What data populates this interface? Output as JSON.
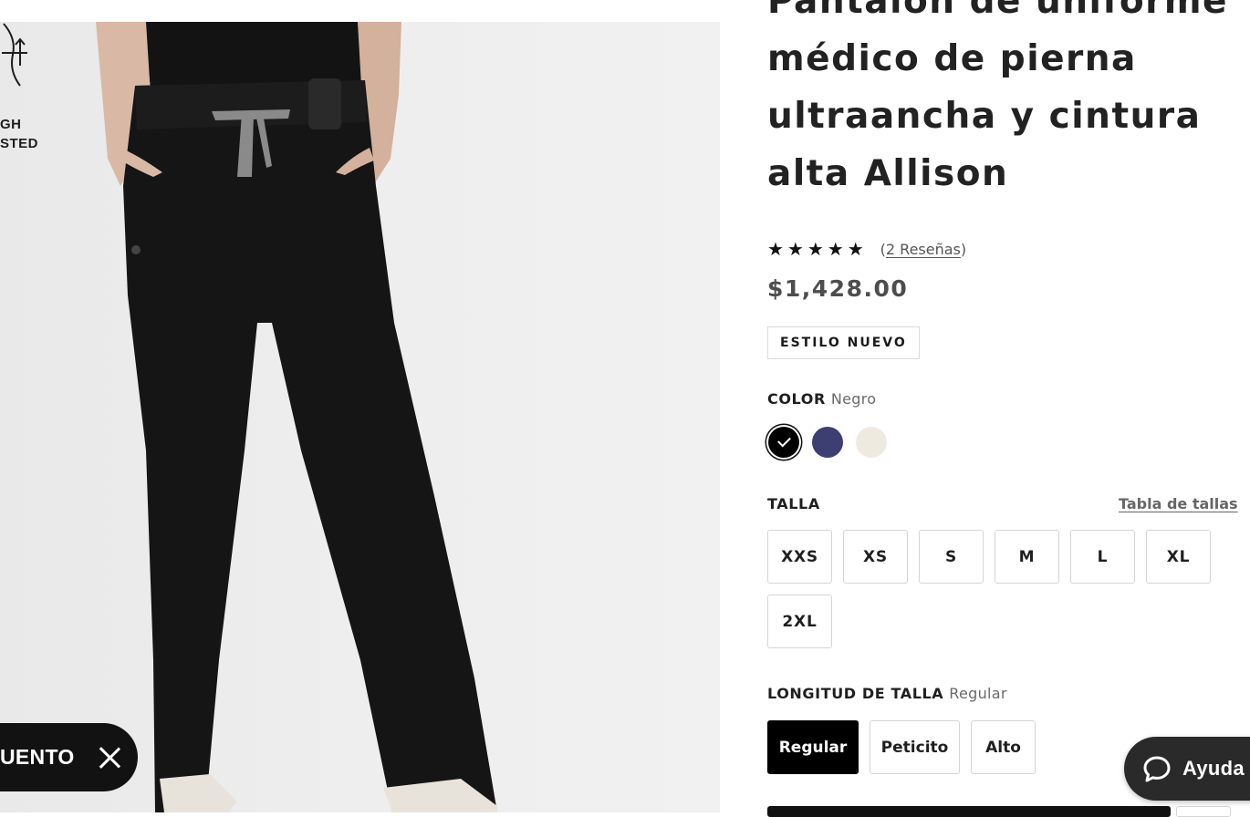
{
  "image": {
    "badge": {
      "line1": "GH",
      "line2": "STED",
      "icon": "waist-icon"
    },
    "promo": {
      "text": "UENTO",
      "close_icon": "close-icon"
    }
  },
  "product": {
    "title": "Pantalón de uniforme médico de pierna ultraancha y cintura alta Allison",
    "rating": {
      "stars": "★★★★★",
      "reviews_open": "(",
      "reviews_text": "2 Reseñas",
      "reviews_close": ")"
    },
    "price": "$1,428.00",
    "badge": "ESTILO NUEVO"
  },
  "color": {
    "label": "COLOR",
    "selected": "Negro",
    "swatches": [
      {
        "color": "#000000",
        "selected": true
      },
      {
        "color": "#3d3f73",
        "selected": false
      },
      {
        "color": "#efeae0",
        "selected": false
      }
    ]
  },
  "size": {
    "label": "TALLA",
    "guide_link": "Tabla de tallas",
    "options": [
      "XXS",
      "XS",
      "S",
      "M",
      "L",
      "XL",
      "2XL"
    ]
  },
  "length": {
    "label": "LONGITUD DE TALLA",
    "selected": "Regular",
    "options": [
      "Regular",
      "Peticito",
      "Alto"
    ]
  },
  "help": {
    "label": "Ayuda",
    "icon": "chat-bubble-icon"
  }
}
